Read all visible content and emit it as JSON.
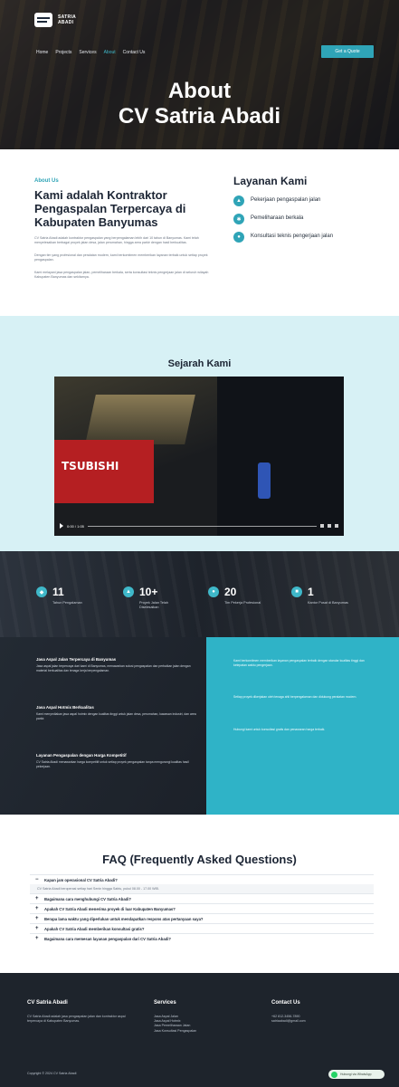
{
  "brand": {
    "line1": "SATRIA",
    "line2": "ABADI"
  },
  "nav": {
    "items": [
      "Home",
      "Projects",
      "Services",
      "About",
      "Contact Us"
    ],
    "active_index": 3,
    "cta": "Get a Quote"
  },
  "hero": {
    "title_line1": "About",
    "title_line2": "CV Satria Abadi"
  },
  "about": {
    "kicker": "About Us",
    "heading": "Kami adalah Kontraktor Pengaspalan Terpercaya di Kabupaten Banyumas",
    "p1": "CV Satria Abadi adalah kontraktor pengaspalan yang berpengalaman lebih dari 10 tahun di Banyumas. Kami telah menyelesaikan berbagai proyek jalan desa, jalan perumahan, hingga area parkir dengan hasil berkualitas.",
    "p2": "Dengan tim yang profesional dan peralatan modern, kami berkomitmen memberikan layanan terbaik untuk setiap proyek pengaspalan.",
    "p3": "Kami melayani jasa pengaspalan jalan, pemeliharaan berkala, serta konsultasi teknis pengerjaan jalan di seluruh wilayah Kabupaten Banyumas dan sekitarnya."
  },
  "layanan": {
    "title": "Layanan Kami",
    "items": [
      {
        "label": "Pekerjaan pengaspalan jalan",
        "icon": "road-icon"
      },
      {
        "label": "Pemeliharaan berkala",
        "icon": "tools-icon"
      },
      {
        "label": "Konsultasi teknis pengerjaan jalan",
        "icon": "chat-icon"
      }
    ]
  },
  "sejarah": {
    "title": "Sejarah Kami",
    "video_brand": "TSUBISHI",
    "video_time": "0:00 / 1:05",
    "video_progress": 0.0
  },
  "stats": [
    {
      "number": "11",
      "label": "Tahun Pengalaman"
    },
    {
      "number": "10+",
      "label": "Proyek Jalan Telah Diselesaikan"
    },
    {
      "number": "20",
      "label": "Tim Pekerja Profesional"
    },
    {
      "number": "1",
      "label": "Kantor Pusat di Banyumas"
    }
  ],
  "info": {
    "blocks": [
      {
        "heading": "Jasa Aspal Jalan Terpercaya di Banyumas",
        "body": "Jasa aspal jalan terpercaya dari kami di Banyumas, menawarkan solusi pengaspalan dan perbaikan jalan dengan material berkualitas dan tenaga kerja berpengalaman."
      },
      {
        "heading": "Jasa Aspal Hotmix Berkualitas",
        "body": "Kami menyediakan jasa aspal hotmix dengan kualitas tinggi untuk jalan desa, perumahan, kawasan industri, dan area parkir."
      },
      {
        "heading": "Layanan Pengaspalan dengan Harga Kompetitif",
        "body": "CV Satria Abadi menawarkan harga kompetitif untuk setiap proyek pengaspalan tanpa mengurangi kualitas hasil pekerjaan."
      }
    ],
    "right": [
      "Kami berkomitmen memberikan layanan pengaspalan terbaik dengan standar kualitas tinggi dan ketepatan waktu pengerjaan.",
      "Setiap proyek dikerjakan oleh tenaga ahli berpengalaman dan didukung peralatan modern.",
      "Hubungi kami untuk konsultasi gratis dan penawaran harga terbaik."
    ]
  },
  "faq": {
    "title": "FAQ (Frequently Asked Questions)",
    "items": [
      {
        "q": "Kapan jam operasional CV Satria Abadi?",
        "open": true,
        "a": "CV Satria Abadi beroperasi setiap hari Senin hingga Sabtu, pukul 08.00 - 17.00 WIB."
      },
      {
        "q": "Bagaimana cara menghubungi CV Satria Abadi?",
        "open": false
      },
      {
        "q": "Apakah CV Satria Abadi menerima proyek di luar Kabupaten Banyumas?",
        "open": false
      },
      {
        "q": "Berapa lama waktu yang diperlukan untuk mendapatkan respons atas pertanyaan saya?",
        "open": false
      },
      {
        "q": "Apakah CV Satria Abadi memberikan konsultasi gratis?",
        "open": false
      },
      {
        "q": "Bagaimana cara memesan layanan pengaspalan dari CV Satria Abadi?",
        "open": false
      }
    ]
  },
  "footer": {
    "col1_title": "CV Satria Abadi",
    "col1_text": "CV Satria Abadi adalah jasa pengaspalan jalan dan kontraktor aspal terpercaya di Kabupaten Banyumas.",
    "col2_title": "Services",
    "col2_items": [
      "Jasa Aspal Jalan",
      "Jasa Aspal Hotmix",
      "Jasa Pemeliharaan Jalan",
      "Jasa Konsultasi Pengaspalan"
    ],
    "col3_title": "Contact Us",
    "col3_items": [
      "+62 812-3456-7890",
      "satriaabadi@gmail.com"
    ],
    "copyright": "Copyright © 2024 CV Satria Abadi",
    "whatsapp": "Hubungi via WhatsApp"
  }
}
